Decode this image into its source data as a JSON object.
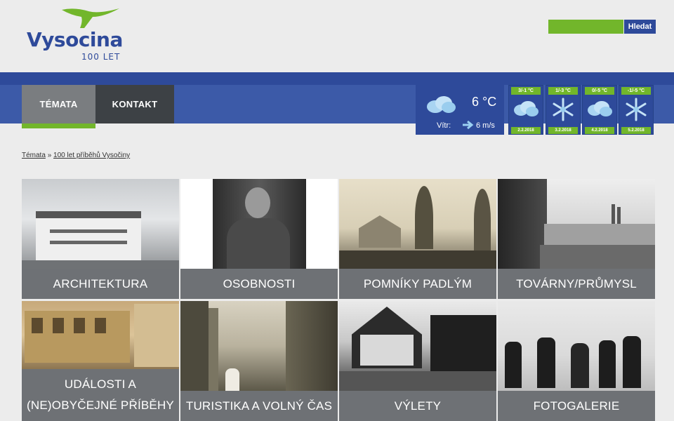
{
  "brand": {
    "name": "Vysocina",
    "subtitle": "100 LET",
    "accent_green": "#72b62b",
    "accent_blue": "#2e4a9a"
  },
  "search": {
    "value": "",
    "button_label": "Hledat"
  },
  "nav": {
    "tabs": [
      {
        "label": "TÉMATA",
        "active": true
      },
      {
        "label": "KONTAKT",
        "active": false
      }
    ]
  },
  "weather": {
    "current": {
      "icon": "cloud-icon",
      "temperature": "6 °C",
      "wind_label": "Vítr:",
      "wind_value": "6 m/s"
    },
    "forecast": [
      {
        "range": "3/-1 °C",
        "icon": "cloud-icon",
        "date": "2.2.2018"
      },
      {
        "range": "1/-3 °C",
        "icon": "snowflake-icon",
        "date": "3.2.2018"
      },
      {
        "range": "0/-5 °C",
        "icon": "cloud-icon",
        "date": "4.2.2018"
      },
      {
        "range": "-1/-5 °C",
        "icon": "snowflake-icon",
        "date": "5.2.2018"
      }
    ]
  },
  "breadcrumb": {
    "items": [
      "Témata",
      "100 let příběhů Vysočiny"
    ],
    "separator": "»"
  },
  "tiles": [
    {
      "title": "ARCHITEKTURA"
    },
    {
      "title": "OSOBNOSTI"
    },
    {
      "title": "POMNÍKY PADLÝM"
    },
    {
      "title": "TOVÁRNY/PRŮMYSL"
    },
    {
      "title_line1": "UDÁLOSTI A",
      "title_line2": "(NE)OBYČEJNÉ PŘÍBĚHY"
    },
    {
      "title": "TURISTIKA A VOLNÝ ČAS"
    },
    {
      "title": "VÝLETY"
    },
    {
      "title": "FOTOGALERIE"
    }
  ]
}
